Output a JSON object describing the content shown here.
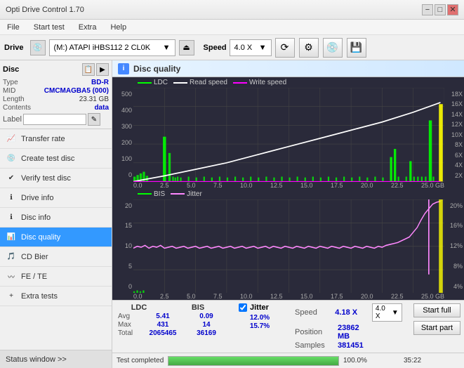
{
  "window": {
    "title": "Opti Drive Control 1.70",
    "min_btn": "−",
    "max_btn": "□",
    "close_btn": "✕"
  },
  "menubar": {
    "items": [
      "File",
      "Start test",
      "Extra",
      "Help"
    ]
  },
  "drivetoolbar": {
    "drive_label": "Drive",
    "drive_value": "(M:) ATAPI iHBS112  2 CL0K",
    "speed_label": "Speed",
    "speed_value": "4.0 X"
  },
  "disc": {
    "title": "Disc",
    "type_key": "Type",
    "type_val": "BD-R",
    "mid_key": "MID",
    "mid_val": "CMCMAGBA5 (000)",
    "length_key": "Length",
    "length_val": "23.31 GB",
    "contents_key": "Contents",
    "contents_val": "data",
    "label_key": "Label",
    "label_placeholder": ""
  },
  "sidebar": {
    "items": [
      {
        "id": "transfer-rate",
        "label": "Transfer rate",
        "active": false
      },
      {
        "id": "create-test-disc",
        "label": "Create test disc",
        "active": false
      },
      {
        "id": "verify-test-disc",
        "label": "Verify test disc",
        "active": false
      },
      {
        "id": "drive-info",
        "label": "Drive info",
        "active": false
      },
      {
        "id": "disc-info",
        "label": "Disc info",
        "active": false
      },
      {
        "id": "disc-quality",
        "label": "Disc quality",
        "active": true
      },
      {
        "id": "cd-bier",
        "label": "CD Bier",
        "active": false
      },
      {
        "id": "fe-te",
        "label": "FE / TE",
        "active": false
      },
      {
        "id": "extra-tests",
        "label": "Extra tests",
        "active": false
      }
    ],
    "status_window": "Status window >>"
  },
  "quality": {
    "title": "Disc quality",
    "panel_icon": "i",
    "legend_top": [
      {
        "label": "LDC",
        "color": "#00ff00"
      },
      {
        "label": "Read speed",
        "color": "#ffffff"
      },
      {
        "label": "Write speed",
        "color": "#ff00ff"
      }
    ],
    "legend_bottom": [
      {
        "label": "BIS",
        "color": "#00ff00"
      },
      {
        "label": "Jitter",
        "color": "#ff88ff"
      }
    ],
    "yaxis_top_left": [
      "500",
      "400",
      "300",
      "200",
      "100",
      "0"
    ],
    "yaxis_top_right": [
      "18X",
      "16X",
      "14X",
      "12X",
      "10X",
      "8X",
      "6X",
      "4X",
      "2X"
    ],
    "yaxis_bottom_left": [
      "20",
      "15",
      "10",
      "5",
      "0"
    ],
    "yaxis_bottom_right": [
      "20%",
      "16%",
      "12%",
      "8%",
      "4%"
    ],
    "xaxis_labels": [
      "0.0",
      "2.5",
      "5.0",
      "7.5",
      "10.0",
      "12.5",
      "15.0",
      "17.5",
      "20.0",
      "22.5",
      "25.0 GB"
    ]
  },
  "stats": {
    "col_headers": [
      "LDC",
      "BIS"
    ],
    "jitter_label": "Jitter",
    "jitter_checked": true,
    "speed_label": "Speed",
    "speed_val": "4.18 X",
    "speed_combo": "4.0 X",
    "rows": [
      {
        "label": "Avg",
        "ldc": "5.41",
        "bis": "0.09",
        "jitter": "12.0%"
      },
      {
        "label": "Max",
        "ldc": "431",
        "bis": "14",
        "jitter": "15.7%"
      },
      {
        "label": "Total",
        "ldc": "2065465",
        "bis": "36169",
        "jitter": ""
      }
    ],
    "position_key": "Position",
    "position_val": "23862 MB",
    "samples_key": "Samples",
    "samples_val": "381451",
    "start_full": "Start full",
    "start_part": "Start part"
  },
  "progress": {
    "fill_pct": 100,
    "pct_text": "100.0%",
    "time_text": "35:22",
    "status_text": "Test completed"
  }
}
